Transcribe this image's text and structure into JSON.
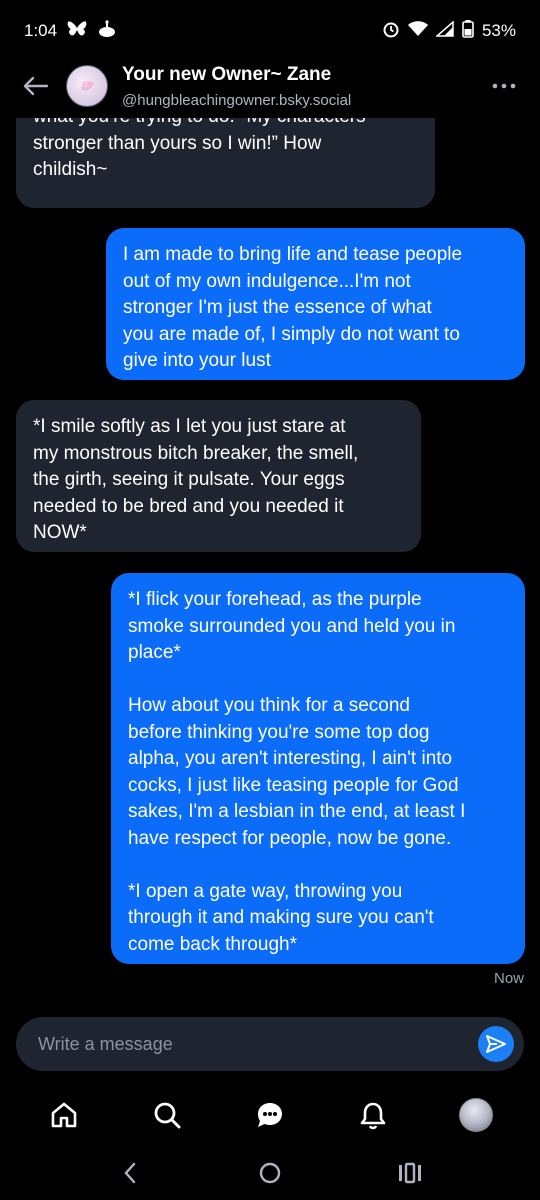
{
  "status_bar": {
    "time": "1:04",
    "battery": "53%",
    "left_icons": [
      "bluesky-butterfly-icon",
      "cake-icon"
    ],
    "right_icons": [
      "alarm-icon",
      "wifi-icon",
      "signal-icon",
      "battery-icon"
    ]
  },
  "header": {
    "title": "Your new Owner~ Zane",
    "handle": "@hungbleachingowner.bsky.social"
  },
  "messages": [
    {
      "sender": "them",
      "text": "what you’re trying to do. “My characters\nstronger than yours so I win!” How\nchildish~"
    },
    {
      "sender": "me",
      "text": "I am made to bring life and tease people\nout of my own indulgence...I'm not\nstronger I'm just the essence of what\nyou are made of, I simply do not want to\ngive into your lust"
    },
    {
      "sender": "them",
      "text": "*I smile softly as I let you just stare at\nmy monstrous bitch breaker, the smell,\nthe girth, seeing it pulsate. Your eggs\nneeded to be bred and you needed it\nNOW*"
    },
    {
      "sender": "me",
      "text": "*I flick your forehead, as the purple\nsmoke surrounded you and held you in\nplace*\n\nHow about you think for a second\nbefore thinking you're some top dog\nalpha, you aren't interesting, I ain't into\ncocks, I just like teasing people for God\nsakes, I'm a lesbian in the end, at least I\nhave respect for people, now be gone.\n\n*I open a gate way, throwing you\nthrough it and making sure you can't\ncome back through*"
    }
  ],
  "timestamp": "Now",
  "composer": {
    "placeholder": "Write a message"
  },
  "tabs": [
    "home-icon",
    "search-icon",
    "chat-icon",
    "notifications-bell-icon",
    "profile-avatar"
  ],
  "colors": {
    "background": "#000000",
    "bubble_them": "#1e2430",
    "bubble_me": "#0b6cfa",
    "accent": "#1d7ff5"
  }
}
